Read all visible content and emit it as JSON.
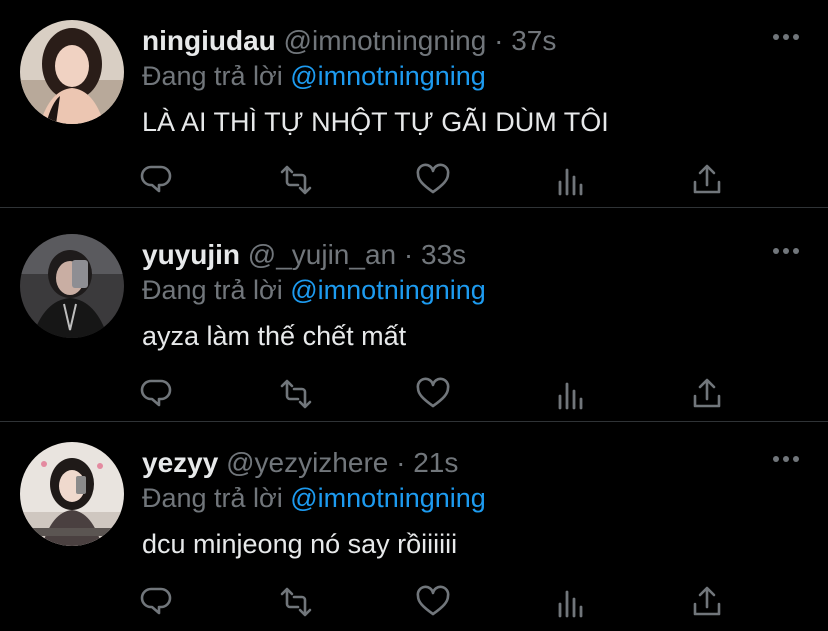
{
  "tweets": [
    {
      "name": "ningiudau",
      "handle": "@imnotningning",
      "separator": "·",
      "time": "37s",
      "replying_prefix": "Đang trả lời ",
      "replying_to": "@imnotningning",
      "text": "LÀ AI THÌ TỰ NHỘT TỰ GÃI DÙM TÔI"
    },
    {
      "name": "yuyujin",
      "handle": "@_yujin_an",
      "separator": "·",
      "time": "33s",
      "replying_prefix": "Đang trả lời ",
      "replying_to": "@imnotningning",
      "text": "ayza làm thế chết mất"
    },
    {
      "name": "yezyy",
      "handle": "@yezyizhere",
      "separator": "·",
      "time": "21s",
      "replying_prefix": "Đang trả lời ",
      "replying_to": "@imnotningning",
      "text": "dcu minjeong nó say rồiiiiii"
    }
  ],
  "icons": {
    "reply": "reply-icon",
    "retweet": "retweet-icon",
    "like": "heart-icon",
    "stats": "analytics-icon",
    "share": "share-icon",
    "more": "more-dots-icon"
  },
  "colors": {
    "background": "#000000",
    "text": "#e7e9ea",
    "muted": "#71767b",
    "mention": "#1d9bf0",
    "divider": "#2f3336"
  }
}
